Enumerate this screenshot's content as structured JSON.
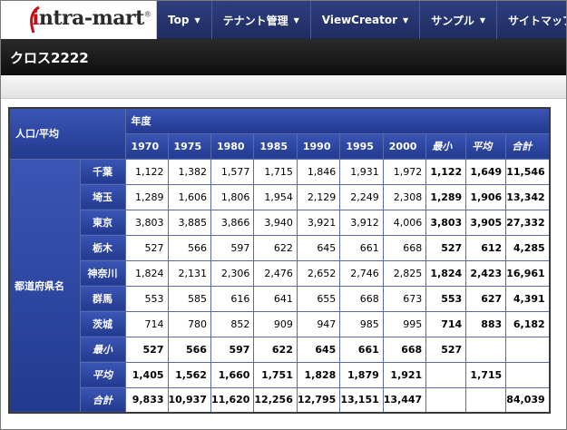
{
  "logo": {
    "text_i": "i",
    "text_rest": "ntra-mart",
    "reg": "®"
  },
  "nav": {
    "items": [
      {
        "label": "Top",
        "caret": "▼"
      },
      {
        "label": "テナント管理",
        "caret": "▼"
      },
      {
        "label": "ViewCreator",
        "caret": "▼"
      },
      {
        "label": "サンプル",
        "caret": "▼"
      },
      {
        "label": "サイトマップ"
      }
    ]
  },
  "page": {
    "title": "クロス2222"
  },
  "pivot": {
    "corner_label": "人口/平均",
    "column_dim_label": "年度",
    "row_dim_label": "都道府県名",
    "columns": [
      "1970",
      "1975",
      "1980",
      "1985",
      "1990",
      "1995",
      "2000"
    ],
    "agg_columns": [
      "最小",
      "平均",
      "合計"
    ],
    "rows": [
      {
        "label": "千葉",
        "values": [
          "1,122",
          "1,382",
          "1,577",
          "1,715",
          "1,846",
          "1,931",
          "1,972"
        ],
        "min": "1,122",
        "avg": "1,649",
        "sum": "11,546"
      },
      {
        "label": "埼玉",
        "values": [
          "1,289",
          "1,606",
          "1,806",
          "1,954",
          "2,129",
          "2,249",
          "2,308"
        ],
        "min": "1,289",
        "avg": "1,906",
        "sum": "13,342"
      },
      {
        "label": "東京",
        "values": [
          "3,803",
          "3,885",
          "3,866",
          "3,940",
          "3,921",
          "3,912",
          "4,006"
        ],
        "min": "3,803",
        "avg": "3,905",
        "sum": "27,332"
      },
      {
        "label": "栃木",
        "values": [
          "527",
          "566",
          "597",
          "622",
          "645",
          "661",
          "668"
        ],
        "min": "527",
        "avg": "612",
        "sum": "4,285"
      },
      {
        "label": "神奈川",
        "values": [
          "1,824",
          "2,131",
          "2,306",
          "2,476",
          "2,652",
          "2,746",
          "2,825"
        ],
        "min": "1,824",
        "avg": "2,423",
        "sum": "16,961"
      },
      {
        "label": "群馬",
        "values": [
          "553",
          "585",
          "616",
          "641",
          "655",
          "668",
          "673"
        ],
        "min": "553",
        "avg": "627",
        "sum": "4,391"
      },
      {
        "label": "茨城",
        "values": [
          "714",
          "780",
          "852",
          "909",
          "947",
          "985",
          "995"
        ],
        "min": "714",
        "avg": "883",
        "sum": "6,182"
      }
    ],
    "agg_rows": [
      {
        "label": "最小",
        "values": [
          "527",
          "566",
          "597",
          "622",
          "645",
          "661",
          "668"
        ],
        "min": "527",
        "avg": "",
        "sum": ""
      },
      {
        "label": "平均",
        "values": [
          "1,405",
          "1,562",
          "1,660",
          "1,751",
          "1,828",
          "1,879",
          "1,921"
        ],
        "min": "",
        "avg": "1,715",
        "sum": ""
      },
      {
        "label": "合計",
        "values": [
          "9,833",
          "10,937",
          "11,620",
          "12,256",
          "12,795",
          "13,151",
          "13,447"
        ],
        "min": "",
        "avg": "",
        "sum": "84,039"
      }
    ]
  }
}
